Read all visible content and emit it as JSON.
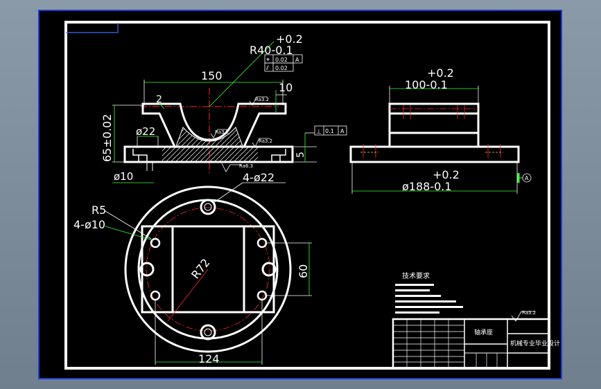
{
  "drawing": {
    "dims": {
      "r40_tol_upper": "+0.2",
      "r40": "R40-0.1",
      "width_150": "150",
      "height_10": "10",
      "gap_2": "2",
      "height_65": "65±0.02",
      "dia_22": "ø22",
      "dia_10": "ø10",
      "height_5": "5",
      "w100_tol_upper": "+0.2",
      "w100": "100-0.1",
      "d188_tol_upper": "+0.2",
      "d188": "ø188-0.1",
      "holes_22": "4-ø22",
      "r5": "R5",
      "holes_10": "4-ø10",
      "r72": "R72",
      "h60": "60",
      "w124": "124"
    },
    "gdt": {
      "pos_value": "0.02",
      "pos_datum": "A",
      "par_value": "0.02",
      "perp_value": "0.1",
      "perp_datum": "A",
      "datum_label": "A"
    },
    "roughness": [
      "Ra3.2",
      "Ra3.2",
      "Ra3.2",
      "Ra6.3",
      "Ra3.2"
    ],
    "notes": {
      "title": "技术要求"
    },
    "title_block": {
      "part_name": "轴承座",
      "school": "机械专业毕业设计"
    }
  }
}
